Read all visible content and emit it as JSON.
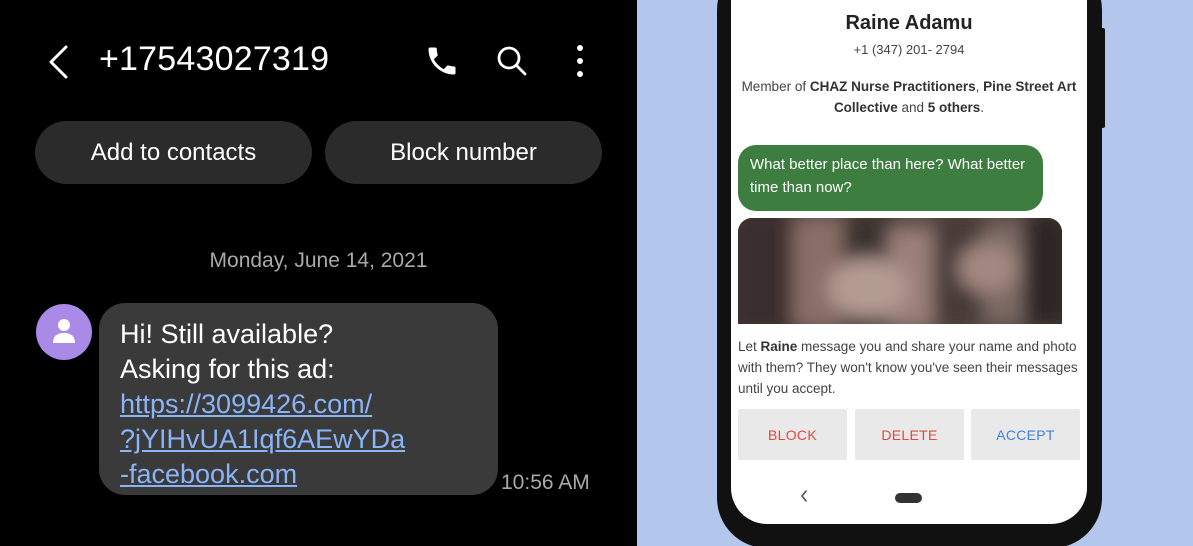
{
  "left_panel": {
    "header": {
      "phone_number": "+17543027319",
      "icons": [
        "back-icon",
        "phone-icon",
        "search-icon",
        "more-options-icon"
      ]
    },
    "actions": {
      "add_to_contacts": "Add to contacts",
      "block_number": "Block number"
    },
    "thread": {
      "date": "Monday, June 14, 2021",
      "message": {
        "line1": "Hi! Still available?",
        "line2": "Asking for this ad:",
        "link_line1": "https://3099426.com/",
        "link_line2": "?jYIHvUA1Iqf6AEwYDa",
        "link_line3": "-facebook.com"
      },
      "time": "10:56 AM"
    },
    "colors": {
      "background": "#000000",
      "bubble": "#3a3a3a",
      "link": "#8ab4f8",
      "avatar": "#a98ae6"
    }
  },
  "right_panel": {
    "contact": {
      "name": "Raine Adamu",
      "phone": "+1 (347) 201- 2794",
      "member_prefix": "Member of ",
      "group1": "CHAZ Nurse Practitioners",
      "sep": ", ",
      "group2": "Pine Street Art Collective",
      "and_text": " and ",
      "others": "5 others",
      "period": "."
    },
    "message": "What better place than here? What better time than now?",
    "prompt": {
      "prefix": "Let ",
      "name": "Raine",
      "suffix": " message you and share your name and photo with them? They won't know you've seen their messages until you accept."
    },
    "buttons": {
      "block": "BLOCK",
      "delete": "DELETE",
      "accept": "ACCEPT"
    },
    "colors": {
      "background": "#b3c6ec",
      "bubble": "#3d7d3f",
      "danger": "#e14a3b",
      "primary": "#3f7fe6"
    }
  }
}
